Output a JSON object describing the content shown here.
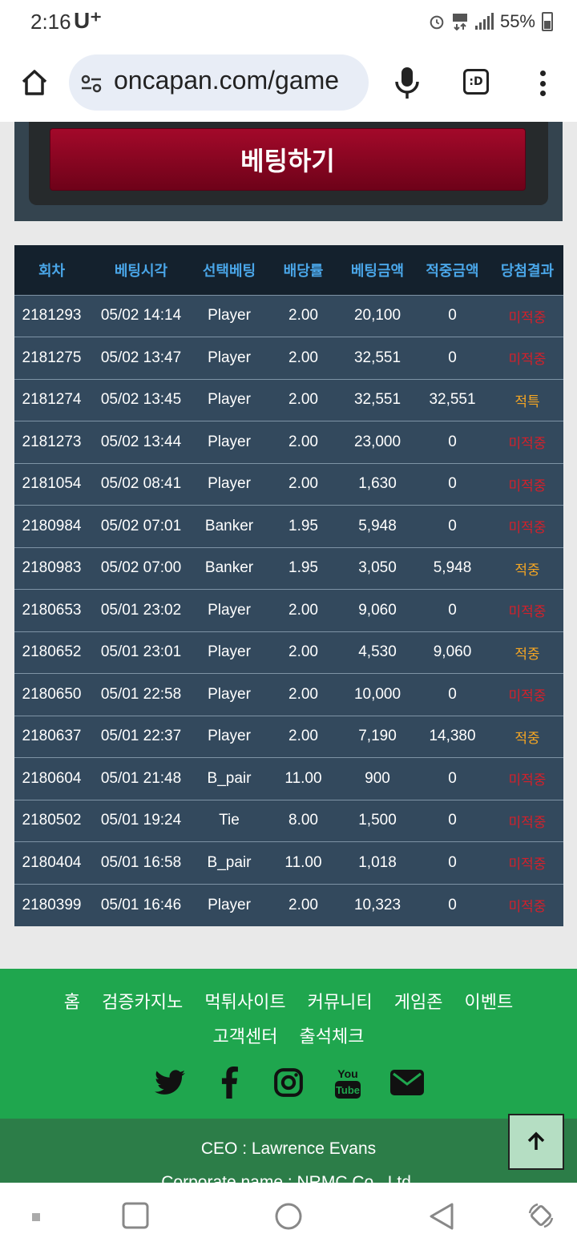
{
  "status": {
    "time": "2:16",
    "carrier": "U⁺",
    "battery": "55%"
  },
  "browser": {
    "url": "oncapan.com/game",
    "tab_label": ":D"
  },
  "bet_button_label": "베팅하기",
  "table": {
    "headers": [
      "회차",
      "베팅시각",
      "선택베팅",
      "배당률",
      "베팅금액",
      "적중금액",
      "당첨결과"
    ],
    "rows": [
      {
        "round": "2181293",
        "time": "05/02 14:14",
        "choice": "Player",
        "odds": "2.00",
        "bet": "20,100",
        "win": "0",
        "result": "미적중",
        "is_win": false
      },
      {
        "round": "2181275",
        "time": "05/02 13:47",
        "choice": "Player",
        "odds": "2.00",
        "bet": "32,551",
        "win": "0",
        "result": "미적중",
        "is_win": false
      },
      {
        "round": "2181274",
        "time": "05/02 13:45",
        "choice": "Player",
        "odds": "2.00",
        "bet": "32,551",
        "win": "32,551",
        "result": "적특",
        "is_win": true
      },
      {
        "round": "2181273",
        "time": "05/02 13:44",
        "choice": "Player",
        "odds": "2.00",
        "bet": "23,000",
        "win": "0",
        "result": "미적중",
        "is_win": false
      },
      {
        "round": "2181054",
        "time": "05/02 08:41",
        "choice": "Player",
        "odds": "2.00",
        "bet": "1,630",
        "win": "0",
        "result": "미적중",
        "is_win": false
      },
      {
        "round": "2180984",
        "time": "05/02 07:01",
        "choice": "Banker",
        "odds": "1.95",
        "bet": "5,948",
        "win": "0",
        "result": "미적중",
        "is_win": false
      },
      {
        "round": "2180983",
        "time": "05/02 07:00",
        "choice": "Banker",
        "odds": "1.95",
        "bet": "3,050",
        "win": "5,948",
        "result": "적중",
        "is_win": true
      },
      {
        "round": "2180653",
        "time": "05/01 23:02",
        "choice": "Player",
        "odds": "2.00",
        "bet": "9,060",
        "win": "0",
        "result": "미적중",
        "is_win": false
      },
      {
        "round": "2180652",
        "time": "05/01 23:01",
        "choice": "Player",
        "odds": "2.00",
        "bet": "4,530",
        "win": "9,060",
        "result": "적중",
        "is_win": true
      },
      {
        "round": "2180650",
        "time": "05/01 22:58",
        "choice": "Player",
        "odds": "2.00",
        "bet": "10,000",
        "win": "0",
        "result": "미적중",
        "is_win": false
      },
      {
        "round": "2180637",
        "time": "05/01 22:37",
        "choice": "Player",
        "odds": "2.00",
        "bet": "7,190",
        "win": "14,380",
        "result": "적중",
        "is_win": true
      },
      {
        "round": "2180604",
        "time": "05/01 21:48",
        "choice": "B_pair",
        "odds": "11.00",
        "bet": "900",
        "win": "0",
        "result": "미적중",
        "is_win": false
      },
      {
        "round": "2180502",
        "time": "05/01 19:24",
        "choice": "Tie",
        "odds": "8.00",
        "bet": "1,500",
        "win": "0",
        "result": "미적중",
        "is_win": false
      },
      {
        "round": "2180404",
        "time": "05/01 16:58",
        "choice": "B_pair",
        "odds": "11.00",
        "bet": "1,018",
        "win": "0",
        "result": "미적중",
        "is_win": false
      },
      {
        "round": "2180399",
        "time": "05/01 16:46",
        "choice": "Player",
        "odds": "2.00",
        "bet": "10,323",
        "win": "0",
        "result": "미적중",
        "is_win": false
      }
    ]
  },
  "footer": {
    "nav": [
      "홈",
      "검증카지노",
      "먹튀사이트",
      "커뮤니티",
      "게임존",
      "이벤트",
      "고객센터",
      "출석체크"
    ],
    "social": [
      "twitter-icon",
      "facebook-icon",
      "instagram-icon",
      "youtube-icon",
      "mail-icon"
    ],
    "ceo": "CEO : Lawrence Evans",
    "corporate": "Corporate name : NRMC Co., Ltd."
  },
  "colors": {
    "lose": "#d4202a",
    "win": "#f5a623",
    "footer": "#1fa64e",
    "header_text": "#4aa6e8"
  }
}
